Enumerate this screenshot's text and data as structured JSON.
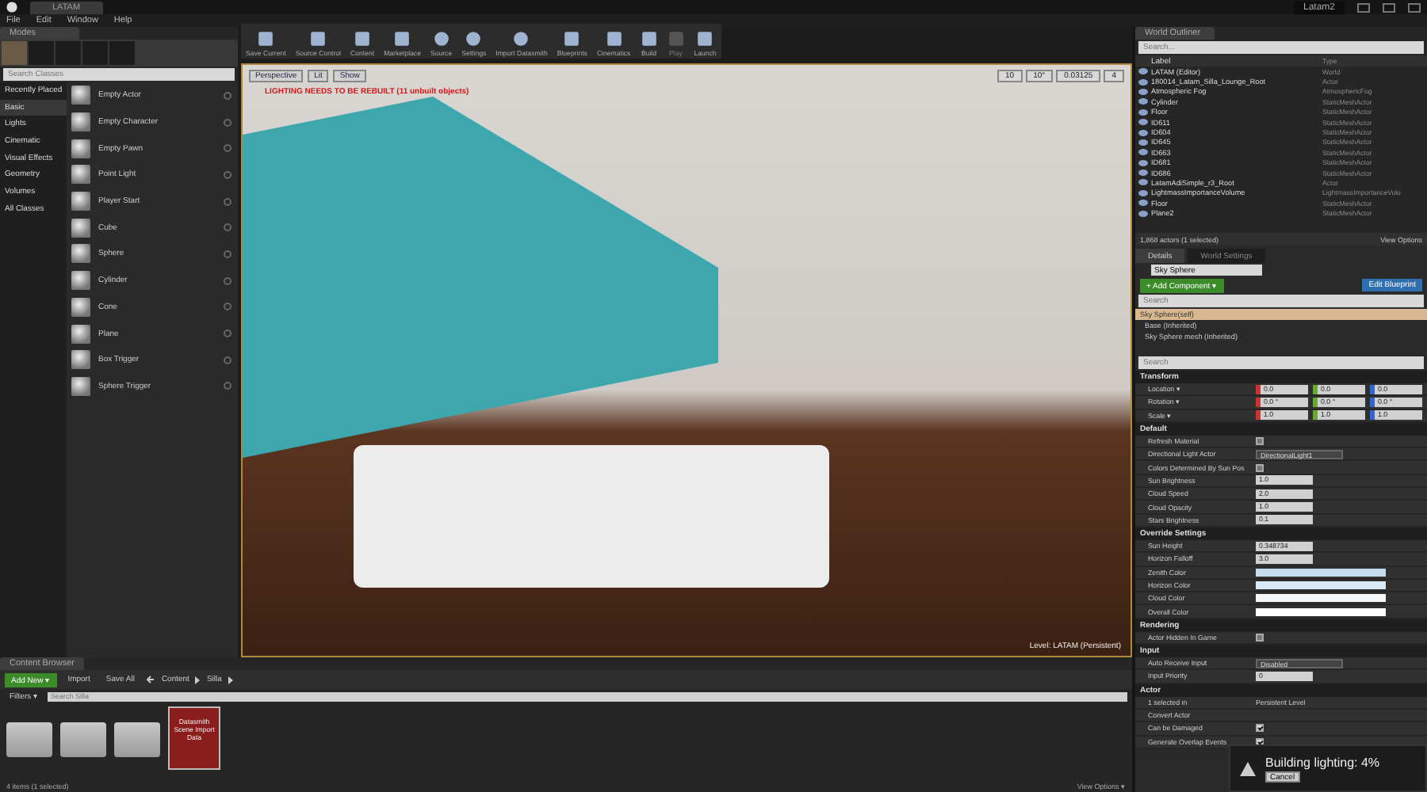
{
  "title_bar": {
    "tab": "LATAM",
    "project": "Latam2"
  },
  "menu": [
    "File",
    "Edit",
    "Window",
    "Help"
  ],
  "modes": {
    "tab": "Modes",
    "search": {
      "placeholder": "Search Classes"
    },
    "categories": [
      {
        "label": "Recently Placed",
        "selected": false
      },
      {
        "label": "Basic",
        "selected": true
      },
      {
        "label": "Lights",
        "selected": false
      },
      {
        "label": "Cinematic",
        "selected": false
      },
      {
        "label": "Visual Effects",
        "selected": false
      },
      {
        "label": "Geometry",
        "selected": false
      },
      {
        "label": "Volumes",
        "selected": false
      },
      {
        "label": "All Classes",
        "selected": false
      }
    ],
    "items": [
      "Empty Actor",
      "Empty Character",
      "Empty Pawn",
      "Point Light",
      "Player Start",
      "Cube",
      "Sphere",
      "Cylinder",
      "Cone",
      "Plane",
      "Box Trigger",
      "Sphere Trigger"
    ]
  },
  "toolbar": [
    {
      "label": "Save Current",
      "disabled": false
    },
    {
      "label": "Source Control",
      "disabled": false
    },
    {
      "label": "Content",
      "disabled": false
    },
    {
      "label": "Marketplace",
      "disabled": false
    },
    {
      "label": "Source",
      "disabled": false
    },
    {
      "label": "Settings",
      "disabled": false
    },
    {
      "label": "Import Datasmith",
      "disabled": false
    },
    {
      "label": "Blueprints",
      "disabled": false
    },
    {
      "label": "Cinematics",
      "disabled": false
    },
    {
      "label": "Build",
      "disabled": false
    },
    {
      "label": "Play",
      "disabled": true
    },
    {
      "label": "Launch",
      "disabled": false
    }
  ],
  "viewport": {
    "buttons": [
      "Perspective",
      "Lit",
      "Show"
    ],
    "warning": "LIGHTING NEEDS TO BE REBUILT (11 unbuilt objects)",
    "snap_values": [
      "10",
      "10°",
      "0.03125",
      "4"
    ],
    "level": "Level:  LATAM (Persistent)"
  },
  "outliner": {
    "tab": "World Outliner",
    "search": {
      "placeholder": "Search..."
    },
    "columns": [
      "Label",
      "Type"
    ],
    "rows": [
      {
        "label": "LATAM (Editor)",
        "type": "World"
      },
      {
        "label": "180014_Latam_Silla_Lounge_Root",
        "type": "Actor"
      },
      {
        "label": "Atmospheric Fog",
        "type": "AtmosphericFog"
      },
      {
        "label": "Cylinder",
        "type": "StaticMeshActor"
      },
      {
        "label": "Floor",
        "type": "StaticMeshActor"
      },
      {
        "label": "ID611",
        "type": "StaticMeshActor"
      },
      {
        "label": "ID604",
        "type": "StaticMeshActor"
      },
      {
        "label": "ID645",
        "type": "StaticMeshActor"
      },
      {
        "label": "ID663",
        "type": "StaticMeshActor"
      },
      {
        "label": "ID681",
        "type": "StaticMeshActor"
      },
      {
        "label": "ID686",
        "type": "StaticMeshActor"
      },
      {
        "label": "LatamAdiSimple_r3_Root",
        "type": "Actor"
      },
      {
        "label": "LightmassImportanceVolume",
        "type": "LightmassImportanceVolu"
      },
      {
        "label": "Floor",
        "type": "StaticMeshActor"
      },
      {
        "label": "Plane2",
        "type": "StaticMeshActor"
      }
    ],
    "footer": "1,868 actors (1 selected)",
    "view_options": "View Options"
  },
  "details": {
    "tabs": [
      {
        "label": "Details",
        "selected": true
      },
      {
        "label": "World Settings",
        "selected": false
      }
    ],
    "name": "Sky Sphere",
    "add_component": "+ Add Component ▾",
    "edit_blueprint": "Edit Blueprint",
    "search": {
      "placeholder": "Search"
    },
    "components": [
      {
        "label": "Sky Sphere(self)",
        "selected": true
      },
      {
        "label": "Base (Inherited)",
        "selected": false
      },
      {
        "label": "Sky Sphere mesh (Inherited)",
        "selected": false
      }
    ],
    "property_search": {
      "placeholder": "Search"
    },
    "sections": [
      {
        "title": "Transform",
        "rows": [
          {
            "kind": "vector",
            "label": "Location ▾",
            "values": [
              "0.0",
              "0.0",
              "0.0"
            ]
          },
          {
            "kind": "vector",
            "label": "Rotation ▾",
            "values": [
              "0.0 °",
              "0.0 °",
              "0.0 °"
            ]
          },
          {
            "kind": "vector",
            "label": "Scale ▾",
            "values": [
              "1.0",
              "1.0",
              "1.0"
            ]
          }
        ]
      },
      {
        "title": "Default",
        "rows": [
          {
            "kind": "checkbox",
            "label": "Refresh Material",
            "checked": false
          },
          {
            "kind": "dropdown",
            "label": "Directional Light Actor",
            "value": "DirectionalLight1"
          },
          {
            "kind": "checkbox",
            "label": "Colors Determined By Sun Pos",
            "checked": false
          },
          {
            "kind": "number",
            "label": "Sun Brightness",
            "value": "1.0"
          },
          {
            "kind": "number",
            "label": "Cloud Speed",
            "value": "2.0"
          },
          {
            "kind": "number",
            "label": "Cloud Opacity",
            "value": "1.0"
          },
          {
            "kind": "number",
            "label": "Stars Brightness",
            "value": "0.1"
          }
        ]
      },
      {
        "title": "Override Settings",
        "rows": [
          {
            "kind": "number",
            "label": "Sun Height",
            "value": "0.348734"
          },
          {
            "kind": "number",
            "label": "Horizon Falloff",
            "value": "3.0"
          },
          {
            "kind": "color",
            "label": "Zenith Color",
            "color": "#c4dcf0"
          },
          {
            "kind": "color",
            "label": "Horizon Color",
            "color": "#d8eaf6"
          },
          {
            "kind": "color",
            "label": "Cloud Color",
            "color": "#f4f6f8"
          },
          {
            "kind": "color",
            "label": "Overall Color",
            "color": "#ffffff"
          }
        ]
      },
      {
        "title": "Rendering",
        "rows": [
          {
            "kind": "checkbox",
            "label": "Actor Hidden In Game",
            "checked": false
          }
        ]
      },
      {
        "title": "Input",
        "rows": [
          {
            "kind": "dropdown",
            "label": "Auto Receive Input",
            "value": "Disabled"
          },
          {
            "kind": "number",
            "label": "Input Priority",
            "value": "0"
          }
        ]
      },
      {
        "title": "Actor",
        "rows": [
          {
            "kind": "text",
            "label": "1 selected in",
            "value": "Persistent Level"
          },
          {
            "kind": "text",
            "label": "Convert Actor"
          },
          {
            "kind": "checkbox",
            "label": "Can be Damaged",
            "checked": true
          },
          {
            "kind": "checkbox",
            "label": "Generate Overlap Events",
            "checked": true
          }
        ]
      }
    ]
  },
  "content_browser": {
    "tab": "Content Browser",
    "add_new": "Add New ▾",
    "import": "Import",
    "save_all": "Save All",
    "path": [
      "Content",
      "Silla"
    ],
    "filters": "Filters ▾",
    "search": {
      "placeholder": "Search Silla"
    },
    "assets": [
      {
        "kind": "folder"
      },
      {
        "kind": "folder"
      },
      {
        "kind": "folder"
      },
      {
        "kind": "asset",
        "label": "Datasmith Scene Import Data",
        "selected": true
      }
    ],
    "footer": "4 items (1 selected)",
    "view_options": "View Options ▾"
  },
  "toast": {
    "message": "Building lighting:  4%",
    "cancel": "Cancel"
  }
}
